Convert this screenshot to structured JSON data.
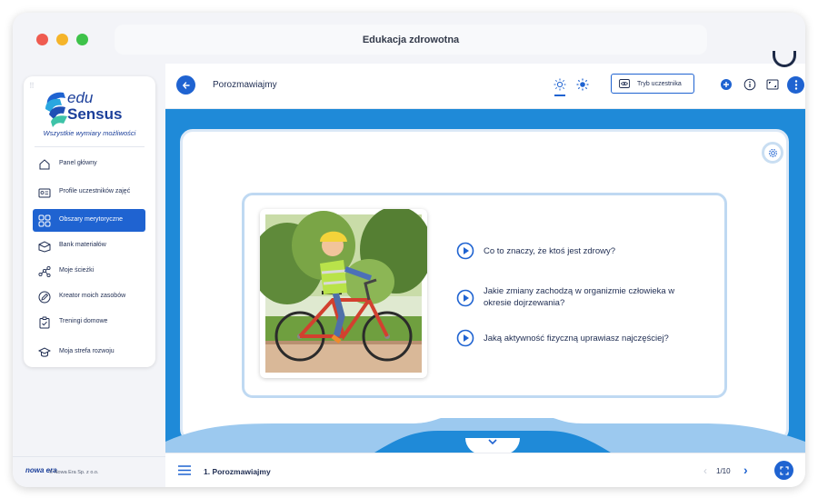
{
  "window": {
    "title": "Edukacja zdrowotna"
  },
  "brand": {
    "name_line1": "edu",
    "name_line2": "Sensus",
    "tagline": "Wszystkie wymiary możliwości"
  },
  "sidebar": {
    "items": [
      {
        "label": "Panel główny",
        "icon": "home-icon",
        "active": false
      },
      {
        "label": "Profile uczestników zajęć",
        "icon": "id-card-icon",
        "active": false
      },
      {
        "label": "Obszary merytoryczne",
        "icon": "grid-icon",
        "active": true
      },
      {
        "label": "Bank materiałów",
        "icon": "box-icon",
        "active": false
      },
      {
        "label": "Moje ścieżki",
        "icon": "path-icon",
        "active": false
      },
      {
        "label": "Kreator moich zasobów",
        "icon": "pencil-icon",
        "active": false
      },
      {
        "label": "Treningi domowe",
        "icon": "clipboard-icon",
        "active": false
      },
      {
        "label": "Moja strefa rozwoju",
        "icon": "graduation-cap-icon",
        "active": false
      }
    ]
  },
  "footer": {
    "publisher_logo": "nowa era",
    "copyright": "© Nowa Era Sp. z o.o."
  },
  "header": {
    "lesson_title": "Porozmawiajmy",
    "mode_button": "Tryb uczestnika"
  },
  "content": {
    "questions": [
      "Co to znaczy, że ktoś jest zdrowy?",
      "Jakie zmiany zachodzą w organizmie człowieka w okresie dojrzewania?",
      "Jaką aktywność fizyczną uprawiasz najczęściej?"
    ]
  },
  "bottom": {
    "breadcrumb": "1. Porozmawiajmy",
    "page_indicator": "1/10"
  },
  "colors": {
    "accent": "#1f63d1",
    "stage": "#1f8ad8",
    "text": "#1f2d52"
  }
}
